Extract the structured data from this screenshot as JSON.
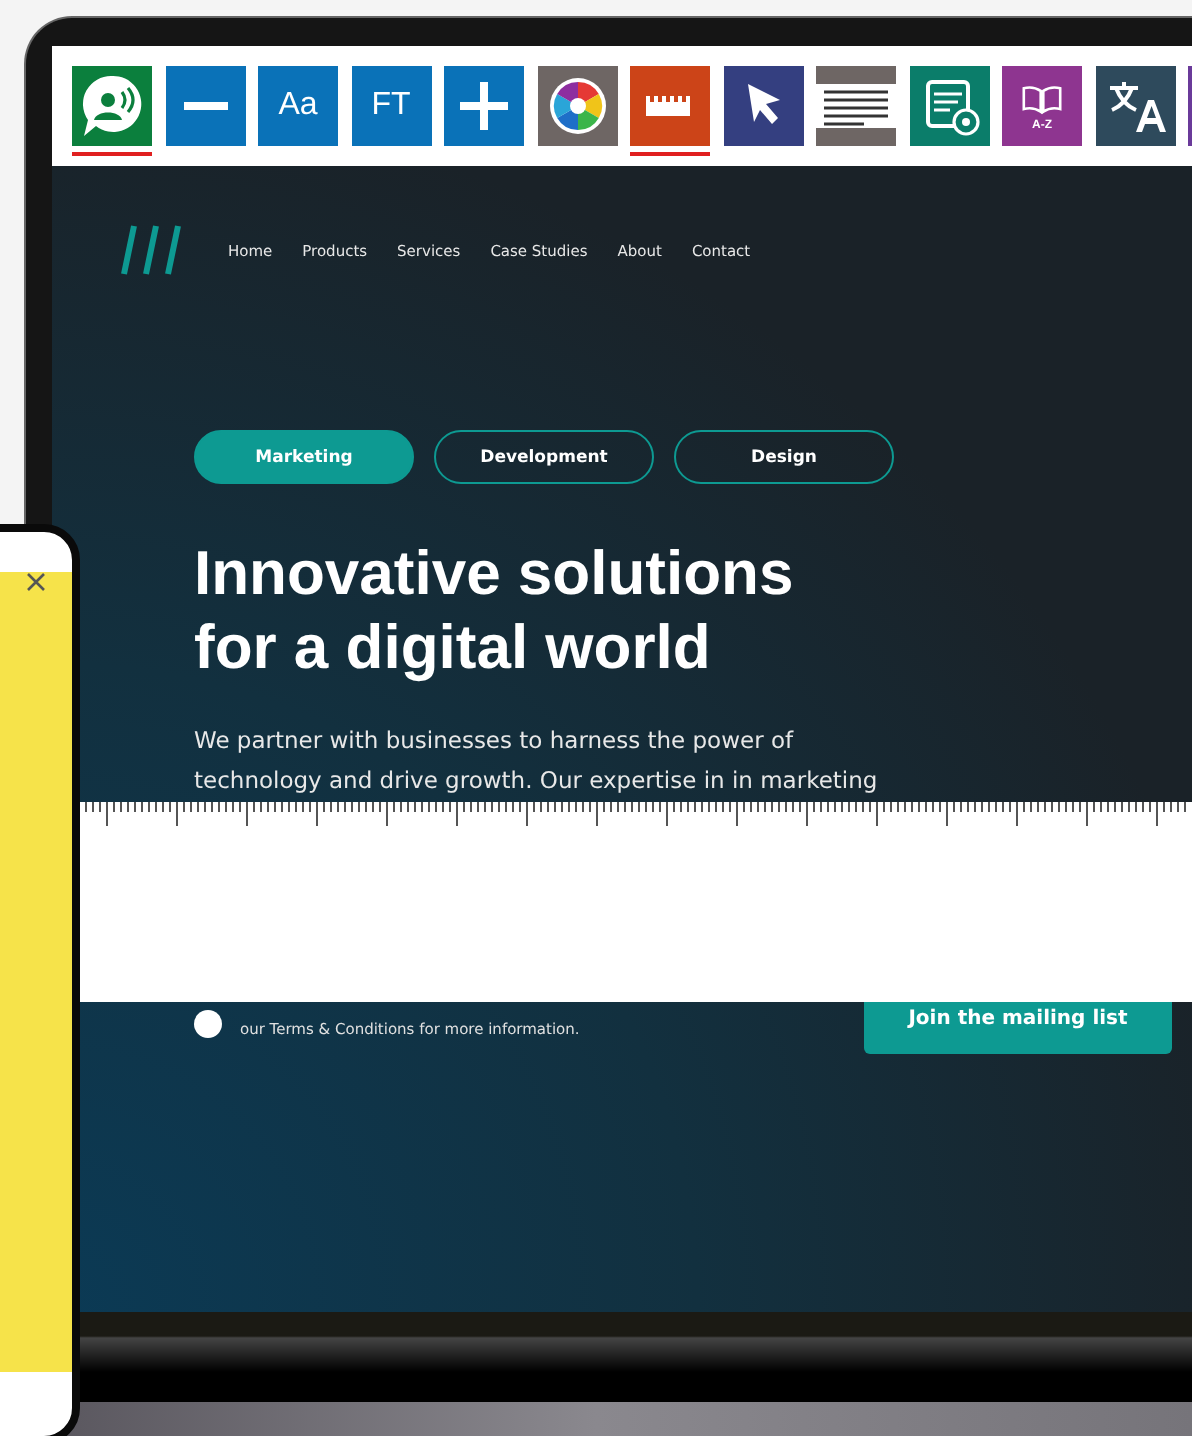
{
  "toolbar": {
    "buttons": [
      {
        "kind": "speech",
        "color": "#0b7f3d",
        "selected": true
      },
      {
        "kind": "minus",
        "color": "#0a72b8",
        "selected": false
      },
      {
        "kind": "text",
        "label": "Aa",
        "color": "#0a72b8",
        "selected": false
      },
      {
        "kind": "text",
        "label": "FT",
        "color": "#0a72b8",
        "selected": false
      },
      {
        "kind": "plus",
        "color": "#0a72b8",
        "selected": false
      },
      {
        "kind": "wheel",
        "color": "#6e6664",
        "selected": false
      },
      {
        "kind": "ruler",
        "color": "#cc4418",
        "selected": true
      },
      {
        "kind": "pointer",
        "color": "#343f80",
        "selected": false
      },
      {
        "kind": "lines",
        "color": "#6e6664",
        "selected": false
      },
      {
        "kind": "reader",
        "color": "#0b7d6a",
        "selected": false
      },
      {
        "kind": "dictionary",
        "label": "A-Z",
        "color": "#8e3590",
        "selected": false
      },
      {
        "kind": "translate",
        "color": "#2e4a5c",
        "selected": false
      },
      {
        "kind": "blank",
        "color": "#6a3a9a",
        "selected": false
      }
    ]
  },
  "nav": {
    "links": [
      "Home",
      "Products",
      "Services",
      "Case Studies",
      "About",
      "Contact"
    ]
  },
  "tabs": [
    {
      "label": "Marketing",
      "selected": true
    },
    {
      "label": "Development",
      "selected": false
    },
    {
      "label": "Design",
      "selected": false
    }
  ],
  "hero": {
    "heading": "Innovative solutions for a digital world",
    "text": "We partner with businesses to harness the power of technology and drive growth. Our expertise in in marketing"
  },
  "signup": {
    "consent_text": "our Terms & Conditions for more information.",
    "consent_checked": false,
    "button": "Join the mailing list"
  },
  "reading_ruler": {
    "on": true
  }
}
